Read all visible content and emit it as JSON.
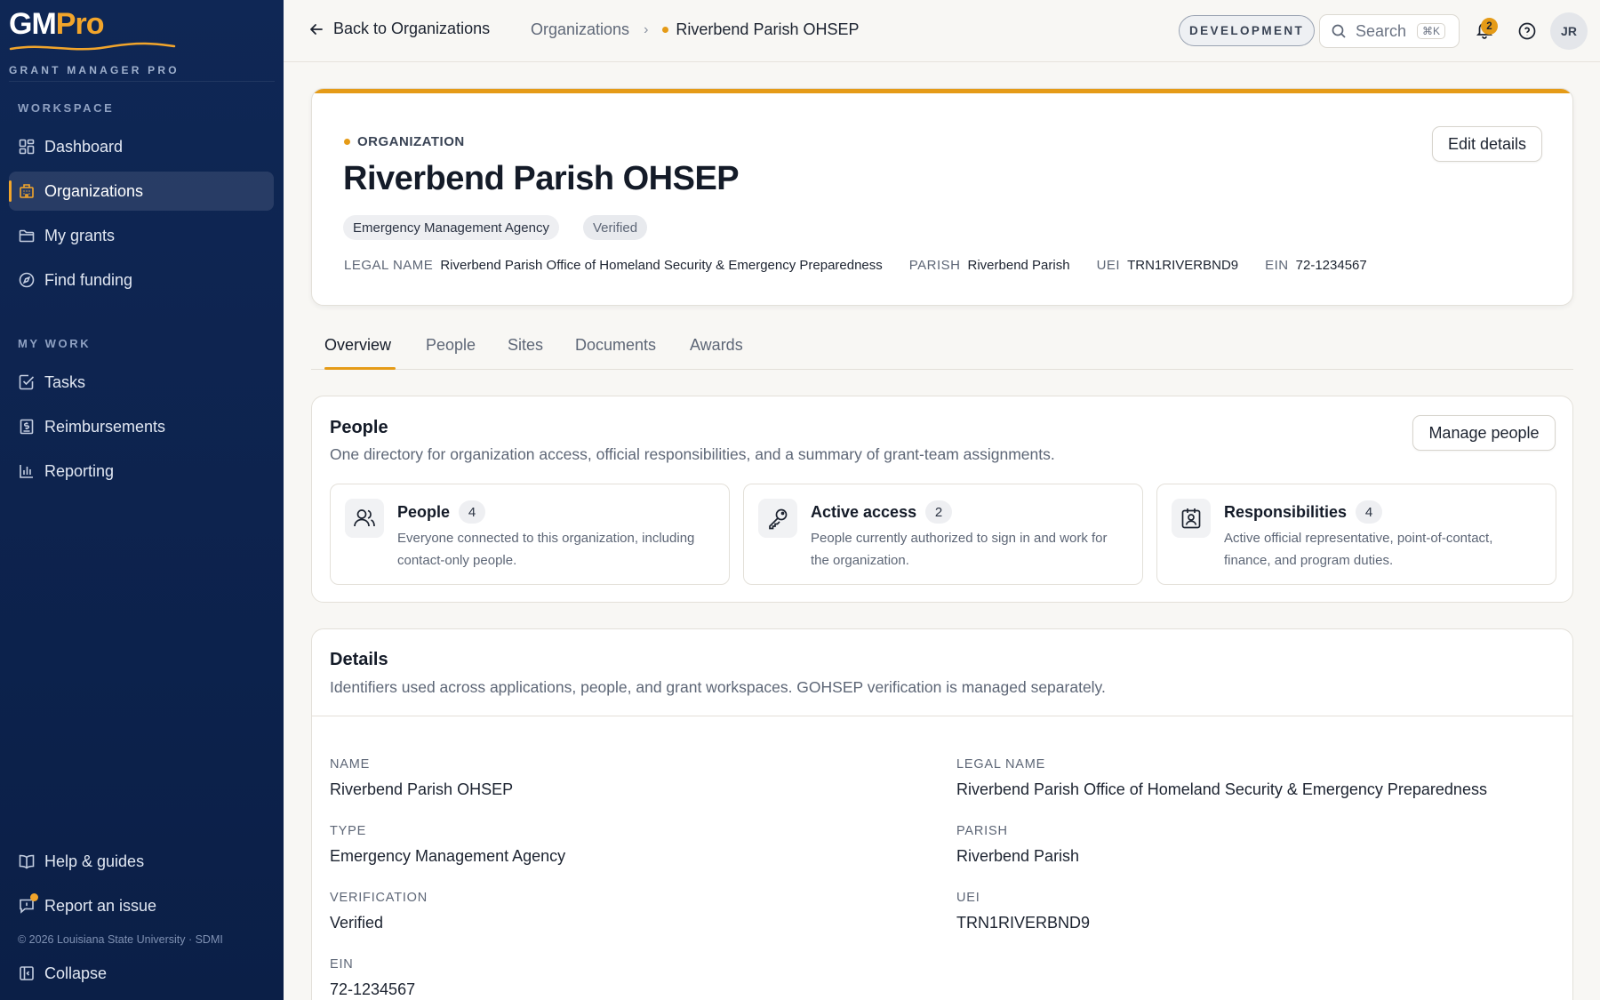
{
  "brand": {
    "logo_gm": "GM",
    "logo_pro": "Pro",
    "subtitle": "GRANT MANAGER PRO",
    "accent": "#f2a52b",
    "sidebar_bg": "#0f2755"
  },
  "sidebar": {
    "workspace_heading": "WORKSPACE",
    "workspace_items": [
      {
        "label": "Dashboard",
        "icon": "dashboard-icon"
      },
      {
        "label": "Organizations",
        "icon": "building-icon",
        "active": true
      },
      {
        "label": "My grants",
        "icon": "folder-icon"
      },
      {
        "label": "Find funding",
        "icon": "compass-icon"
      }
    ],
    "mywork_heading": "MY WORK",
    "mywork_items": [
      {
        "label": "Tasks",
        "icon": "checkbox-icon"
      },
      {
        "label": "Reimbursements",
        "icon": "receipt-icon"
      },
      {
        "label": "Reporting",
        "icon": "bar-chart-icon"
      }
    ],
    "help_label": "Help & guides",
    "report_label": "Report an issue",
    "copyright": "© 2026 Louisiana State University · SDMI",
    "collapse_label": "Collapse"
  },
  "topbar": {
    "back_label": "Back to Organizations",
    "breadcrumb_root": "Organizations",
    "breadcrumb_current": "Riverbend Parish OHSEP",
    "env_badge": "DEVELOPMENT",
    "search_placeholder": "Search",
    "search_shortcut": "⌘K",
    "notification_count": "2",
    "avatar_initials": "JR"
  },
  "org": {
    "eyebrow": "ORGANIZATION",
    "title": "Riverbend Parish OHSEP",
    "type_pill": "Emergency Management Agency",
    "status_pill": "Verified",
    "edit_label": "Edit details",
    "meta": {
      "legal_label": "LEGAL NAME",
      "legal_value": "Riverbend Parish Office of Homeland Security & Emergency Preparedness",
      "parish_label": "PARISH",
      "parish_value": "Riverbend Parish",
      "uei_label": "UEI",
      "uei_value": "TRN1RIVERBND9",
      "ein_label": "EIN",
      "ein_value": "72-1234567"
    }
  },
  "tabs": [
    "Overview",
    "People",
    "Sites",
    "Documents",
    "Awards"
  ],
  "people_section": {
    "title": "People",
    "description": "One directory for organization access, official responsibilities, and a summary of grant-team assignments.",
    "manage_label": "Manage people",
    "stats": [
      {
        "title": "People",
        "count": "4",
        "desc": "Everyone connected to this organization, including contact-only people."
      },
      {
        "title": "Active access",
        "count": "2",
        "desc": "People currently authorized to sign in and work for the organization."
      },
      {
        "title": "Responsibilities",
        "count": "4",
        "desc": "Active official representative, point-of-contact, finance, and program duties."
      }
    ]
  },
  "details_section": {
    "title": "Details",
    "description": "Identifiers used across applications, people, and grant workspaces. GOHSEP verification is managed separately.",
    "fields": {
      "name_label": "NAME",
      "name_value": "Riverbend Parish OHSEP",
      "legal_label": "LEGAL NAME",
      "legal_value": "Riverbend Parish Office of Homeland Security & Emergency Preparedness",
      "type_label": "TYPE",
      "type_value": "Emergency Management Agency",
      "parish_label": "PARISH",
      "parish_value": "Riverbend Parish",
      "verification_label": "VERIFICATION",
      "verification_value": "Verified",
      "uei_label": "UEI",
      "uei_value": "TRN1RIVERBND9",
      "ein_label": "EIN",
      "ein_value": "72-1234567"
    }
  }
}
